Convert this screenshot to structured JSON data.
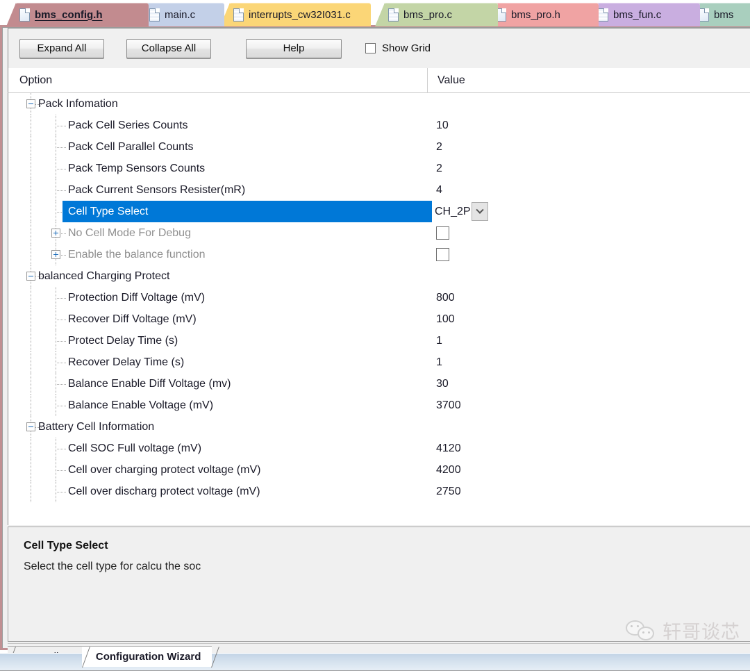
{
  "editor_tabs": [
    {
      "label": "bms_config.h",
      "color": "#c28b8f",
      "active": true,
      "icon": "file-icon",
      "icon_style": "plain"
    },
    {
      "label": "main.c",
      "color": "#c3d0e8",
      "active": false,
      "icon": "file-icon",
      "icon_style": "hatched"
    },
    {
      "label": "interrupts_cw32I031.c",
      "color": "#fbd677",
      "active": false,
      "icon": "file-icon",
      "icon_style": "hatched"
    },
    {
      "label": "bms_pro.c",
      "color": "#c3d5a6",
      "active": false,
      "icon": "file-icon",
      "icon_style": "hatched"
    },
    {
      "label": "bms_pro.h",
      "color": "#f0a3a3",
      "active": false,
      "icon": "file-icon",
      "icon_style": "plain"
    },
    {
      "label": "bms_fun.c",
      "color": "#c9aee0",
      "active": false,
      "icon": "file-icon",
      "icon_style": "hatched"
    },
    {
      "label": "bms",
      "color": "#a9cfbe",
      "active": false,
      "icon": "file-icon",
      "icon_style": "plain"
    }
  ],
  "toolbar": {
    "expand_all": "Expand All",
    "collapse_all": "Collapse All",
    "help": "Help",
    "show_grid": "Show Grid",
    "show_grid_checked": false
  },
  "grid_header": {
    "option": "Option",
    "value": "Value"
  },
  "tree": [
    {
      "type": "group",
      "label": "Pack Infomation",
      "state": "expanded",
      "value": ""
    },
    {
      "type": "child",
      "label": "Pack Cell Series Counts",
      "value": "10"
    },
    {
      "type": "child",
      "label": "Pack Cell Parallel Counts",
      "value": "2"
    },
    {
      "type": "child",
      "label": "Pack Temp Sensors Counts",
      "value": "2"
    },
    {
      "type": "child",
      "label": "Pack Current Sensors Resister(mR)",
      "value": "4"
    },
    {
      "type": "child",
      "label": "Cell Type Select",
      "value": "CH_2P",
      "editor": "combo",
      "selected": true
    },
    {
      "type": "child",
      "label": "No Cell Mode For Debug",
      "value": "",
      "editor": "checkbox",
      "checked": false,
      "disabled": true,
      "state": "collapsed"
    },
    {
      "type": "child",
      "label": "Enable the balance function",
      "value": "",
      "editor": "checkbox",
      "checked": false,
      "disabled": true,
      "state": "collapsed"
    },
    {
      "type": "group",
      "label": "balanced Charging Protect",
      "state": "expanded",
      "value": ""
    },
    {
      "type": "child",
      "label": "Protection Diff Voltage (mV)",
      "value": "800"
    },
    {
      "type": "child",
      "label": "Recover Diff Voltage (mV)",
      "value": "100"
    },
    {
      "type": "child",
      "label": "Protect Delay Time (s)",
      "value": "1"
    },
    {
      "type": "child",
      "label": "Recover Delay Time (s)",
      "value": "1"
    },
    {
      "type": "child",
      "label": "Balance Enable Diff Voltage (mv)",
      "value": "30"
    },
    {
      "type": "child",
      "label": "Balance Enable Voltage (mV)",
      "value": "3700"
    },
    {
      "type": "group",
      "label": "Battery Cell Information",
      "state": "expanded",
      "value": ""
    },
    {
      "type": "child",
      "label": "Cell SOC Full voltage (mV)",
      "value": "4120"
    },
    {
      "type": "child",
      "label": "Cell over charging protect voltage (mV)",
      "value": "4200"
    },
    {
      "type": "child",
      "label": "Cell over discharg protect voltage (mV)",
      "value": "2750"
    }
  ],
  "description": {
    "title": "Cell Type Select",
    "text": "Select the cell type for  calcu the soc"
  },
  "bottom_tabs": [
    {
      "label": "Text Editor",
      "active": false
    },
    {
      "label": "Configuration Wizard",
      "active": true
    }
  ],
  "watermark": {
    "text": "轩哥谈芯",
    "icon": "wechat-icon"
  },
  "colors": {
    "selection": "#0078d7",
    "frame": "#c08f92",
    "toolbar_bg": "#f0f0f0"
  }
}
